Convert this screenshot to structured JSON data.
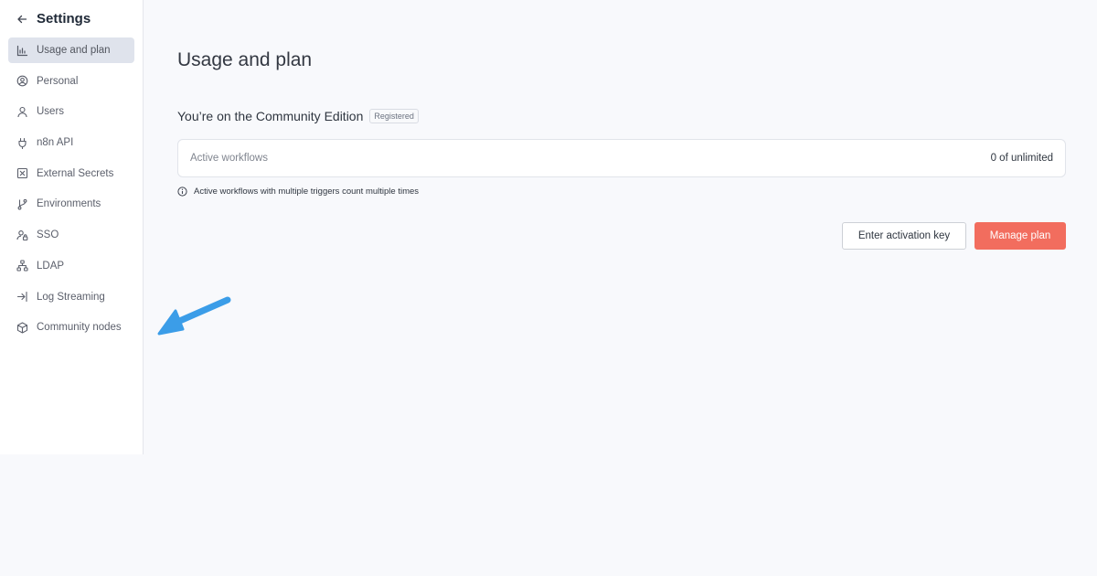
{
  "sidebar": {
    "title": "Settings",
    "items": [
      {
        "label": "Usage and plan",
        "icon": "bar-chart-icon",
        "active": true
      },
      {
        "label": "Personal",
        "icon": "user-circle-icon"
      },
      {
        "label": "Users",
        "icon": "user-icon"
      },
      {
        "label": "n8n API",
        "icon": "plug-icon"
      },
      {
        "label": "External Secrets",
        "icon": "vault-icon"
      },
      {
        "label": "Environments",
        "icon": "git-branch-icon"
      },
      {
        "label": "SSO",
        "icon": "user-lock-icon"
      },
      {
        "label": "LDAP",
        "icon": "network-icon"
      },
      {
        "label": "Log Streaming",
        "icon": "sign-in-icon"
      },
      {
        "label": "Community nodes",
        "icon": "cube-icon"
      }
    ]
  },
  "main": {
    "title": "Usage and plan",
    "edition_text": "You’re on the Community Edition",
    "edition_badge": "Registered",
    "usage": {
      "label": "Active workflows",
      "value": "0 of unlimited"
    },
    "note": "Active workflows with multiple triggers count multiple times",
    "buttons": {
      "activation": "Enter activation key",
      "manage": "Manage plan"
    }
  },
  "colors": {
    "primary": "#f26d5e",
    "active_nav_bg": "#dfe3ec",
    "annotation_arrow": "#3b9de8"
  }
}
